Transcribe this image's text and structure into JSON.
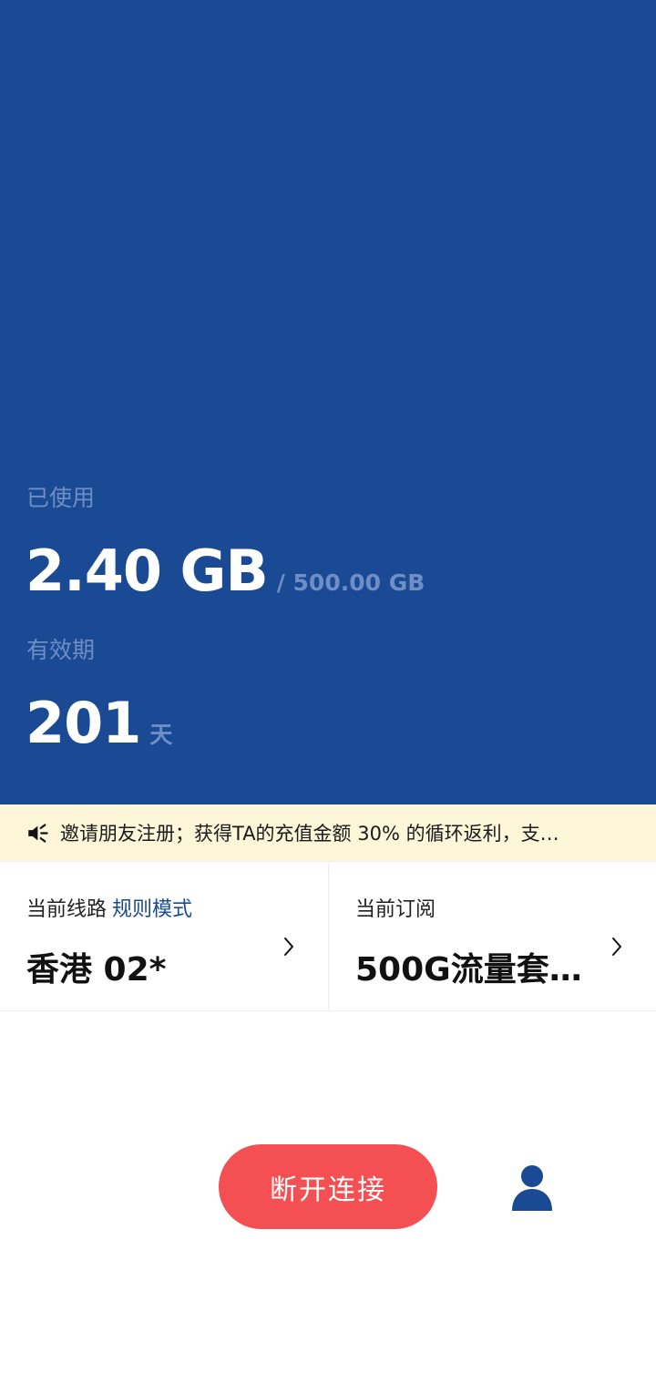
{
  "usage": {
    "label": "已使用",
    "used": "2.40 GB",
    "total": "/ 500.00 GB"
  },
  "validity": {
    "label": "有效期",
    "days": "201",
    "unit": "天"
  },
  "notice": {
    "icon": "speaker-icon",
    "text": "邀请朋友注册；获得TA的充值金额 30% 的循环返利，支…"
  },
  "route_card": {
    "caption": "当前线路",
    "mode": "规则模式",
    "value": "香港 02*"
  },
  "subscription_card": {
    "caption": "当前订阅",
    "value": "500G流量套…"
  },
  "actions": {
    "disconnect_label": "断开连接",
    "profile_icon": "user-icon"
  },
  "colors": {
    "primary": "#1b4a94",
    "muted": "#6f8ec6",
    "danger": "#f44f52",
    "notice_bg": "#fdf6d9"
  }
}
